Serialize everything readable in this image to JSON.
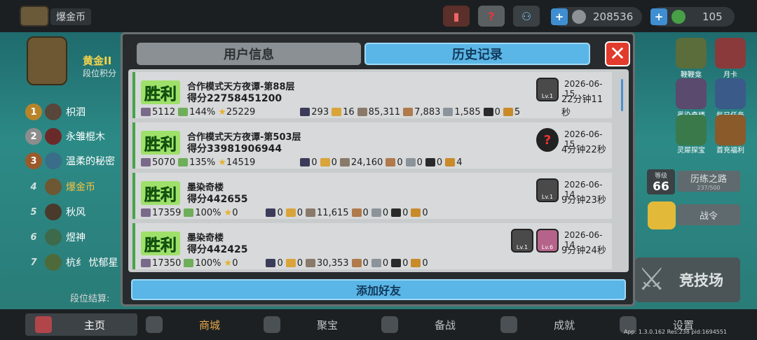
{
  "topbar": {
    "player_name": "爆金币",
    "icons": [
      "book-icon",
      "help-icon",
      "friends-icon"
    ],
    "currency1": "208536",
    "currency2": "105"
  },
  "rank": {
    "title": "黄金II",
    "subtitle": "段位积分",
    "list": [
      {
        "num": "1",
        "name": "枳泗"
      },
      {
        "num": "2",
        "name": "永雏棍木"
      },
      {
        "num": "3",
        "name": "温柔的秘密"
      },
      {
        "num": "4",
        "name": "爆金币"
      },
      {
        "num": "5",
        "name": "秋风"
      },
      {
        "num": "6",
        "name": "煜神"
      },
      {
        "num": "7",
        "name": "杭纟 忧郁星"
      }
    ],
    "footer": "段位结算:"
  },
  "right_panel": {
    "icons": [
      {
        "label": "鞭鞭龛",
        "icon": "dragon-icon"
      },
      {
        "label": "月卡",
        "icon": "card-icon"
      },
      {
        "label": "墨染奇楼",
        "icon": "tower-icon"
      },
      {
        "label": "每日任务",
        "icon": "tasks-icon"
      },
      {
        "label": "灵犀探宝",
        "icon": "treasure-icon"
      },
      {
        "label": "首充福利",
        "icon": "gift-icon"
      }
    ],
    "level_label": "等级",
    "level": "66",
    "path_label": "历练之路",
    "path_progress": "237/500",
    "pass_label": "战令",
    "arena_label": "竞技场"
  },
  "modal": {
    "tab_user": "用户信息",
    "tab_history": "历史记录",
    "close": "✕",
    "add_friend": "添加好友",
    "entries": [
      {
        "result": "胜利",
        "mode": "合作模式天方夜谭-第88层",
        "score": "得分22758451200",
        "date": "2026-06-15",
        "duration": "22分钟11秒",
        "heroes": [
          {
            "type": "hero",
            "lv": "Lv.1"
          }
        ],
        "stats": {
          "s1": "5112",
          "s2": "144%",
          "s3": "25229",
          "s4": "293",
          "s5": "16",
          "s6": "85,311",
          "s7": "7,883",
          "s8": "1,585",
          "s9": "0",
          "s10": "5"
        }
      },
      {
        "result": "胜利",
        "mode": "合作模式天方夜谭-第503层",
        "score": "得分33981906944",
        "date": "2026-06-15",
        "duration": "4分钟22秒",
        "heroes": [
          {
            "type": "mystery",
            "lv": "?"
          }
        ],
        "stats": {
          "s1": "5070",
          "s2": "135%",
          "s3": "14519",
          "s4": "0",
          "s5": "0",
          "s6": "24,160",
          "s7": "0",
          "s8": "0",
          "s9": "0",
          "s10": "4"
        }
      },
      {
        "result": "胜利",
        "mode": "墨染奇楼",
        "score": "得分442655",
        "date": "2026-06-14",
        "duration": "9分钟23秒",
        "heroes": [
          {
            "type": "hero",
            "lv": "Lv.1"
          }
        ],
        "stats": {
          "s1": "17359",
          "s2": "100%",
          "s3": "0",
          "s4": "0",
          "s5": "0",
          "s6": "11,615",
          "s7": "0",
          "s8": "0",
          "s9": "0",
          "s10": "0"
        }
      },
      {
        "result": "胜利",
        "mode": "墨染奇楼",
        "score": "得分442425",
        "date": "2026-06-14",
        "duration": "9分钟24秒",
        "heroes": [
          {
            "type": "hero",
            "lv": "Lv.1"
          },
          {
            "type": "hero",
            "lv": "Lv.6"
          }
        ],
        "stats": {
          "s1": "17350",
          "s2": "100%",
          "s3": "0",
          "s4": "0",
          "s5": "0",
          "s6": "30,353",
          "s7": "0",
          "s8": "0",
          "s9": "0",
          "s10": "0"
        }
      }
    ]
  },
  "bottombar": {
    "items": [
      {
        "label": "主页"
      },
      {
        "label": "商城"
      },
      {
        "label": "聚宝"
      },
      {
        "label": "备战"
      },
      {
        "label": "成就"
      },
      {
        "label": "设置"
      }
    ],
    "build_info": "App: 1.3.0.162 Res:238 pid:1694551"
  },
  "colors": {
    "accent_blue": "#5ab6e6",
    "win_green": "#9fe06a",
    "close_red": "#e23a2c"
  }
}
